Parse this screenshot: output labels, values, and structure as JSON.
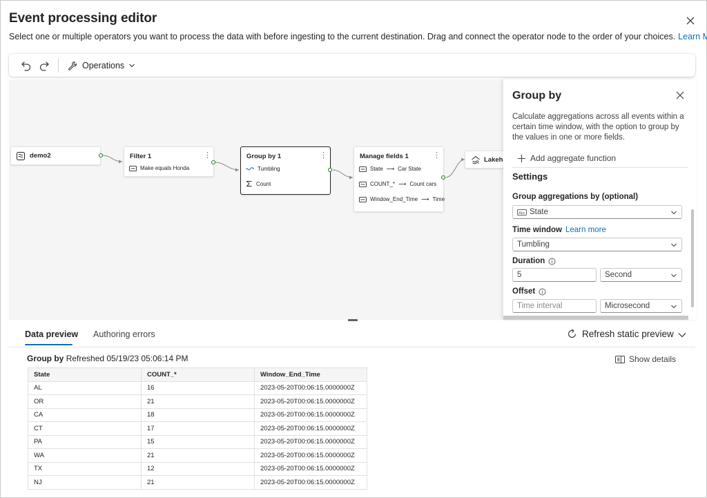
{
  "dialog": {
    "title": "Event processing editor",
    "description": "Select one or multiple operators you want to process the data with before ingesting to the current destination. Drag and connect the operator node to the order of your choices.",
    "learn_more": "Learn More"
  },
  "toolbar": {
    "operations_label": "Operations"
  },
  "canvas": {
    "nodes": {
      "source": {
        "title": "demo2",
        "icon": "eventstream-icon"
      },
      "filter": {
        "title": "Filter 1",
        "lines": [
          "Make equals Honda"
        ]
      },
      "groupby": {
        "title": "Group by 1",
        "lines": [
          "Tumbling",
          "Count"
        ]
      },
      "manage": {
        "title": "Manage fields 1",
        "lines": [
          "State",
          "Car State",
          "COUNT_*",
          "Count cars",
          "Window_End_Time",
          "Time"
        ]
      },
      "lakehouse": {
        "title": "Lakeho",
        "icon": "lakehouse-icon"
      }
    }
  },
  "panel": {
    "title": "Group by",
    "description": "Calculate aggregations across all events within a certain time window, with the option to group by the values in one or more fields.",
    "add_function": "Add aggregate function",
    "settings_heading": "Settings",
    "group_by_label": "Group aggregations by (optional)",
    "group_by_value": "State",
    "time_window_label": "Time window",
    "time_window_link": "Learn more",
    "time_window_value": "Tumbling",
    "duration_label": "Duration",
    "duration_value": "5",
    "duration_unit": "Second",
    "offset_label": "Offset",
    "offset_placeholder": "Time interval",
    "offset_unit": "Microsecond"
  },
  "preview": {
    "tabs": [
      "Data preview",
      "Authoring errors"
    ],
    "refresh_label": "Refresh static preview",
    "heading_bold": "Group by",
    "heading_rest": "Refreshed 05/19/23 05:06:14 PM",
    "show_details": "Show details",
    "columns": [
      "State",
      "COUNT_*",
      "Window_End_Time"
    ],
    "rows": [
      [
        "AL",
        "16",
        "2023-05-20T00:06:15.0000000Z"
      ],
      [
        "OR",
        "21",
        "2023-05-20T00:06:15.0000000Z"
      ],
      [
        "CA",
        "18",
        "2023-05-20T00:06:15.0000000Z"
      ],
      [
        "CT",
        "17",
        "2023-05-20T00:06:15.0000000Z"
      ],
      [
        "PA",
        "15",
        "2023-05-20T00:06:15.0000000Z"
      ],
      [
        "WA",
        "21",
        "2023-05-20T00:06:15.0000000Z"
      ],
      [
        "TX",
        "12",
        "2023-05-20T00:06:15.0000000Z"
      ],
      [
        "NJ",
        "21",
        "2023-05-20T00:06:15.0000000Z"
      ]
    ]
  },
  "colors": {
    "accent": "#0f6cbd",
    "port": "#107c10",
    "canvas_bg": "#f5f5f5"
  }
}
